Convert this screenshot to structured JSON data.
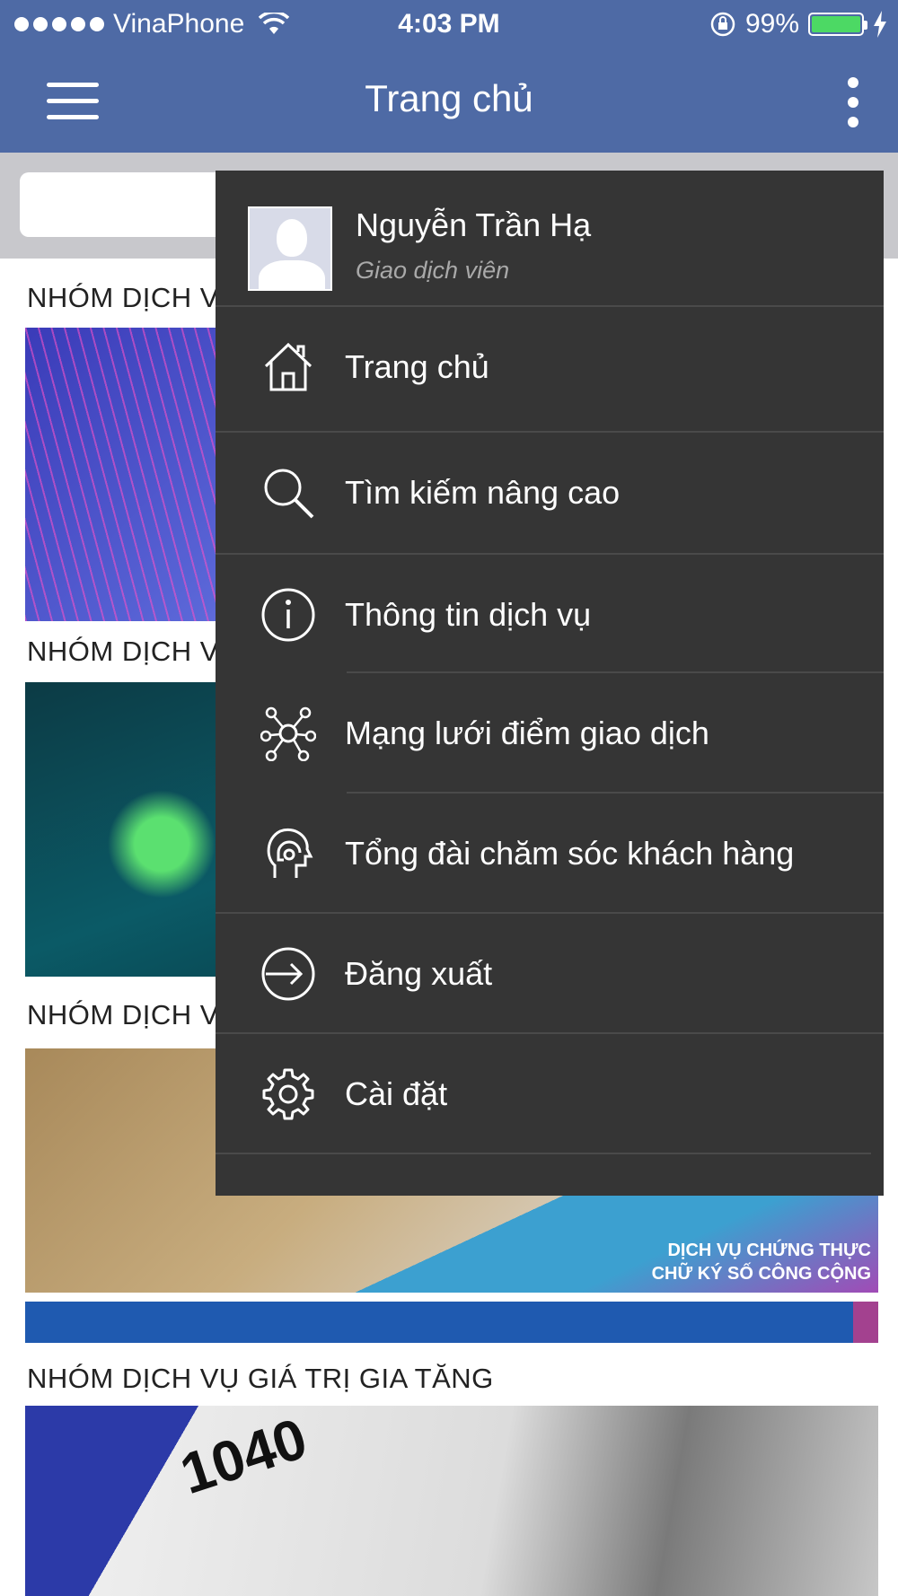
{
  "status_bar": {
    "carrier": "VinaPhone",
    "time": "4:03 PM",
    "battery": "99%"
  },
  "header": {
    "title": "Trang chủ"
  },
  "sections": [
    {
      "title": "NHÓM DỊCH V"
    },
    {
      "title": "NHÓM DỊCH V"
    },
    {
      "title": "NHÓM DỊCH V"
    },
    {
      "title": "NHÓM DỊCH VỤ GIÁ TRỊ GIA TĂNG"
    }
  ],
  "banner": {
    "line1": "DỊCH VỤ CHỨNG THỰC",
    "line2": "CHỮ KÝ SỐ CÔNG CỘNG",
    "form_number": "1040"
  },
  "drawer": {
    "user_name": "Nguyễn Trần Hạ",
    "user_role": "Giao dịch viên",
    "items": [
      {
        "label": "Trang chủ",
        "icon": "home-icon"
      },
      {
        "label": "Tìm kiếm nâng cao",
        "icon": "search-icon"
      },
      {
        "label": "Thông tin dịch vụ",
        "icon": "info-icon"
      },
      {
        "label": "Mạng lưới điểm giao dịch",
        "icon": "network-icon"
      },
      {
        "label": "Tổng đài chăm sóc khách hàng",
        "icon": "headset-icon"
      },
      {
        "label": "Đăng xuất",
        "icon": "logout-icon"
      },
      {
        "label": "Cài đặt",
        "icon": "gear-icon"
      }
    ]
  },
  "colors": {
    "header_bg": "#4e6aa5",
    "drawer_bg": "#353535"
  }
}
